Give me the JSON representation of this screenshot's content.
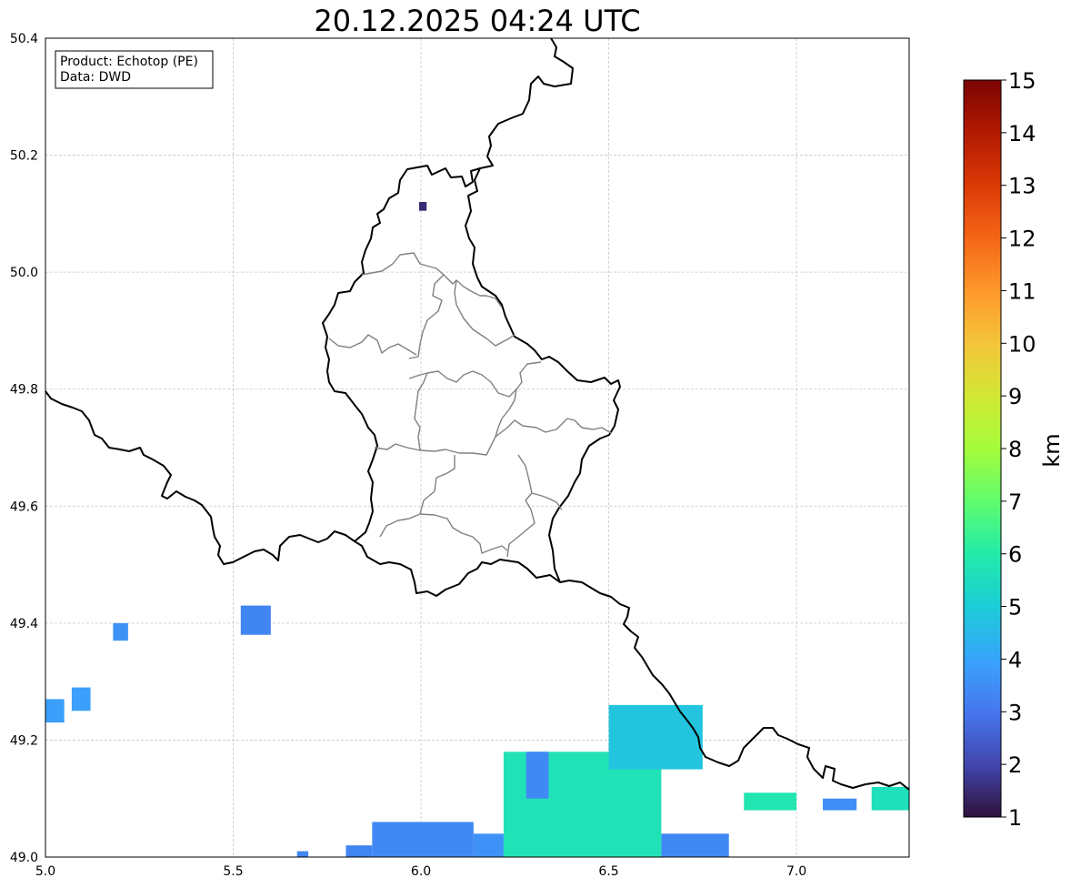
{
  "title": "20.12.2025 04:24 UTC",
  "info_box": {
    "product_line": "Product: Echotop (PE)",
    "data_line": "Data: DWD"
  },
  "chart_data": {
    "type": "heatmap",
    "projection": "plate carree (lon/lat)",
    "x_range": [
      5.0,
      7.3
    ],
    "y_range": [
      49.0,
      50.4
    ],
    "x_ticks": [
      "5.0",
      "5.5",
      "6.0",
      "6.5",
      "7.0"
    ],
    "y_ticks": [
      "49.0",
      "49.2",
      "49.4",
      "49.6",
      "49.8",
      "50.0",
      "50.2",
      "50.4"
    ],
    "grid": true,
    "colorbar": {
      "label": "km",
      "min": 1,
      "max": 15,
      "ticks": [
        "1",
        "2",
        "3",
        "4",
        "5",
        "6",
        "7",
        "8",
        "9",
        "10",
        "11",
        "12",
        "13",
        "14",
        "15"
      ],
      "colormap": "turbo",
      "placement": "right"
    },
    "echo_regions": [
      {
        "lon": [
          5.995,
          6.015
        ],
        "lat": [
          50.105,
          50.12
        ],
        "echotop_km": 1.5
      },
      {
        "lon": [
          5.52,
          5.6
        ],
        "lat": [
          49.38,
          49.43
        ],
        "echotop_km": 3.3
      },
      {
        "lon": [
          5.18,
          5.22
        ],
        "lat": [
          49.37,
          49.4
        ],
        "echotop_km": 3.6
      },
      {
        "lon": [
          5.0,
          5.05
        ],
        "lat": [
          49.23,
          49.27
        ],
        "echotop_km": 3.9
      },
      {
        "lon": [
          5.07,
          5.12
        ],
        "lat": [
          49.25,
          49.29
        ],
        "echotop_km": 3.9
      },
      {
        "lon": [
          5.87,
          6.14
        ],
        "lat": [
          49.0,
          49.06
        ],
        "echotop_km": 3.4
      },
      {
        "lon": [
          5.8,
          5.87
        ],
        "lat": [
          49.0,
          49.02
        ],
        "echotop_km": 3.3
      },
      {
        "lon": [
          5.67,
          5.7
        ],
        "lat": [
          49.0,
          49.01
        ],
        "echotop_km": 3.3
      },
      {
        "lon": [
          6.14,
          6.22
        ],
        "lat": [
          49.0,
          49.04
        ],
        "echotop_km": 3.6
      },
      {
        "lon": [
          6.22,
          6.64
        ],
        "lat": [
          49.0,
          49.18
        ],
        "echotop_km": 5.7
      },
      {
        "lon": [
          6.28,
          6.34
        ],
        "lat": [
          49.1,
          49.18
        ],
        "echotop_km": 3.4
      },
      {
        "lon": [
          6.5,
          6.75
        ],
        "lat": [
          49.15,
          49.26
        ],
        "echotop_km": 4.8
      },
      {
        "lon": [
          6.64,
          6.82
        ],
        "lat": [
          49.0,
          49.04
        ],
        "echotop_km": 3.4
      },
      {
        "lon": [
          6.86,
          7.0
        ],
        "lat": [
          49.08,
          49.11
        ],
        "echotop_km": 5.8
      },
      {
        "lon": [
          7.2,
          7.3
        ],
        "lat": [
          49.08,
          49.12
        ],
        "echotop_km": 5.6
      },
      {
        "lon": [
          7.07,
          7.16
        ],
        "lat": [
          49.08,
          49.1
        ],
        "echotop_km": 3.5
      }
    ]
  }
}
